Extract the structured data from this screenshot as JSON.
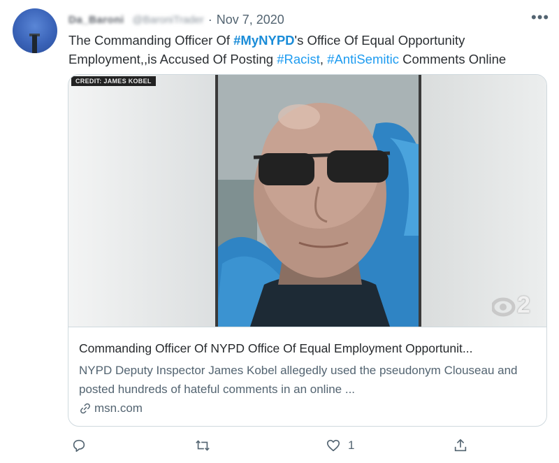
{
  "tweet": {
    "display_name": "Da_Baroni",
    "handle": "@BaroniTrader",
    "separator": "·",
    "date": "Nov 7, 2020",
    "more_label": "•••",
    "text": {
      "part1": "The Commanding Officer Of ",
      "hashtag1": "#MyNYPD",
      "part2": "'s  Office Of Equal Opportunity Employment,,is  Accused Of Posting ",
      "hashtag2": "#Racist",
      "part3": ", ",
      "hashtag3": "#AntiSemitic",
      "part4": " Comments Online"
    }
  },
  "card": {
    "image_credit": "CREDIT: JAMES KOBEL",
    "image_logo": "2",
    "title": "Commanding Officer Of NYPD Office Of Equal Employment Opportunit...",
    "description": "NYPD Deputy Inspector James Kobel allegedly used the pseudonym Clouseau and posted hundreds of hateful comments in an online ...",
    "domain": "msn.com"
  },
  "actions": {
    "reply_icon": "reply-icon",
    "retweet_icon": "retweet-icon",
    "like_icon": "like-icon",
    "like_count": "1",
    "share_icon": "share-icon"
  },
  "colors": {
    "accent": "#1d9bf0",
    "muted": "#536471",
    "border": "#cfd9de"
  }
}
